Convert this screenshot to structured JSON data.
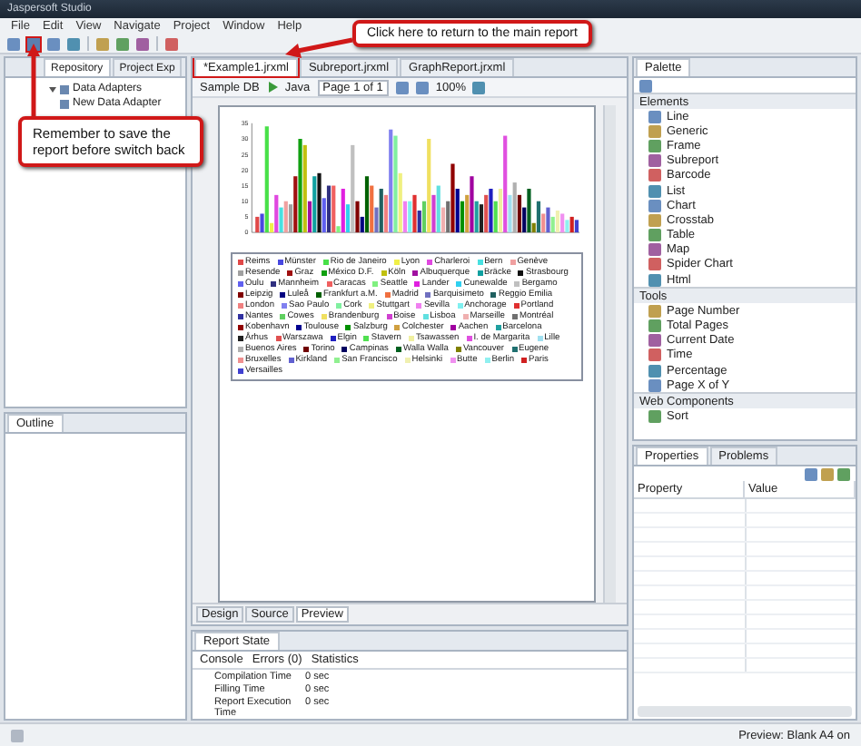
{
  "window": {
    "title": "Jaspersoft Studio"
  },
  "menu": [
    "File",
    "Edit",
    "View",
    "Navigate",
    "Project",
    "Window",
    "Help"
  ],
  "left_tabs": [
    {
      "label": "Repository",
      "selected": true
    },
    {
      "label": "Project Exp",
      "selected": false
    }
  ],
  "tree": [
    {
      "label": "Data Adapters",
      "expanded": true,
      "children": [
        {
          "label": "New Data Adapter"
        }
      ]
    }
  ],
  "outline": {
    "title": "Outline"
  },
  "editor_tabs": [
    {
      "label": "*Example1.jrxml",
      "selected": true
    },
    {
      "label": "Subreport.jrxml",
      "selected": false
    },
    {
      "label": "GraphReport.jrxml",
      "selected": false
    }
  ],
  "editor_toolbar": {
    "datasource": "Sample DB",
    "language": "Java",
    "page": "Page 1 of 1",
    "zoom": "100%"
  },
  "chart_data": {
    "type": "bar",
    "ylim": [
      0,
      35
    ],
    "yticks": [
      0,
      5,
      10,
      15,
      20,
      25,
      30,
      35
    ],
    "series": [
      {
        "name": "Reims",
        "color": "#e04848",
        "values": [
          5
        ]
      },
      {
        "name": "Münster",
        "color": "#4848e0",
        "values": [
          6
        ]
      },
      {
        "name": "Rio de Janeiro",
        "color": "#48e048",
        "values": [
          34
        ]
      },
      {
        "name": "Lyon",
        "color": "#f0f048",
        "values": [
          3
        ]
      },
      {
        "name": "Charleroi",
        "color": "#e048e0",
        "values": [
          12
        ]
      },
      {
        "name": "Bern",
        "color": "#48e0e0",
        "values": [
          8
        ]
      },
      {
        "name": "Genève",
        "color": "#f0a0a0",
        "values": [
          10
        ]
      },
      {
        "name": "Resende",
        "color": "#a0a0a0",
        "values": [
          9
        ]
      },
      {
        "name": "Graz",
        "color": "#a01010",
        "values": [
          18
        ]
      },
      {
        "name": "México D.F.",
        "color": "#10a010",
        "values": [
          30
        ]
      },
      {
        "name": "Köln",
        "color": "#c0c010",
        "values": [
          28
        ]
      },
      {
        "name": "Albuquerque",
        "color": "#a010a0",
        "values": [
          10
        ]
      },
      {
        "name": "Bräcke",
        "color": "#10a0a0",
        "values": [
          18
        ]
      },
      {
        "name": "Strasbourg",
        "color": "#101010",
        "values": [
          19
        ]
      },
      {
        "name": "Oulu",
        "color": "#6060f0",
        "values": [
          11
        ]
      },
      {
        "name": "Mannheim",
        "color": "#303080",
        "values": [
          15
        ]
      },
      {
        "name": "Caracas",
        "color": "#f06060",
        "values": [
          15
        ]
      },
      {
        "name": "Seattle",
        "color": "#80f080",
        "values": [
          2
        ]
      },
      {
        "name": "Lander",
        "color": "#e020e0",
        "values": [
          14
        ]
      },
      {
        "name": "Cunewalde",
        "color": "#30d0f0",
        "values": [
          9
        ]
      },
      {
        "name": "Bergamo",
        "color": "#c0c0c0",
        "values": [
          28
        ]
      },
      {
        "name": "Leipzig",
        "color": "#800000",
        "values": [
          10
        ]
      },
      {
        "name": "Luleå",
        "color": "#000080",
        "values": [
          5
        ]
      },
      {
        "name": "Frankfurt a.M.",
        "color": "#006000",
        "values": [
          18
        ]
      },
      {
        "name": "Madrid",
        "color": "#f07040",
        "values": [
          15
        ]
      },
      {
        "name": "Barquisimeto",
        "color": "#7070c0",
        "values": [
          8
        ]
      },
      {
        "name": "Reggio Emilia",
        "color": "#206060",
        "values": [
          14
        ]
      },
      {
        "name": "London",
        "color": "#f08080",
        "values": [
          12
        ]
      },
      {
        "name": "Sao Paulo",
        "color": "#8080f0",
        "values": [
          33
        ]
      },
      {
        "name": "Cork",
        "color": "#80f0a0",
        "values": [
          31
        ]
      },
      {
        "name": "Stuttgart",
        "color": "#f0f080",
        "values": [
          19
        ]
      },
      {
        "name": "Sevilla",
        "color": "#f080f0",
        "values": [
          10
        ]
      },
      {
        "name": "Anchorage",
        "color": "#80f0f0",
        "values": [
          10
        ]
      },
      {
        "name": "Portland",
        "color": "#e03030",
        "values": [
          12
        ]
      },
      {
        "name": "Nantes",
        "color": "#3030a0",
        "values": [
          7
        ]
      },
      {
        "name": "Cowes",
        "color": "#60d060",
        "values": [
          10
        ]
      },
      {
        "name": "Brandenburg",
        "color": "#f0e060",
        "values": [
          30
        ]
      },
      {
        "name": "Boise",
        "color": "#d040d0",
        "values": [
          12
        ]
      },
      {
        "name": "Lisboa",
        "color": "#60e0e0",
        "values": [
          15
        ]
      },
      {
        "name": "Marseille",
        "color": "#f0b0b0",
        "values": [
          8
        ]
      },
      {
        "name": "Montréal",
        "color": "#707070",
        "values": [
          10
        ]
      },
      {
        "name": "Kobenhavn",
        "color": "#900000",
        "values": [
          22
        ]
      },
      {
        "name": "Toulouse",
        "color": "#000090",
        "values": [
          14
        ]
      },
      {
        "name": "Salzburg",
        "color": "#009000",
        "values": [
          10
        ]
      },
      {
        "name": "Colchester",
        "color": "#d0a040",
        "values": [
          12
        ]
      },
      {
        "name": "Aachen",
        "color": "#a000a0",
        "values": [
          18
        ]
      },
      {
        "name": "Barcelona",
        "color": "#20a0a0",
        "values": [
          10
        ]
      },
      {
        "name": "Århus",
        "color": "#202020",
        "values": [
          9
        ]
      },
      {
        "name": "Warszawa",
        "color": "#e05050",
        "values": [
          12
        ]
      },
      {
        "name": "Elgin",
        "color": "#2020c0",
        "values": [
          14
        ]
      },
      {
        "name": "Stavern",
        "color": "#50e050",
        "values": [
          10
        ]
      },
      {
        "name": "Tsawassen",
        "color": "#f0f0a0",
        "values": [
          14
        ]
      },
      {
        "name": "I. de Margarita",
        "color": "#e050e0",
        "values": [
          31
        ]
      },
      {
        "name": "Lille",
        "color": "#a0e0f0",
        "values": [
          12
        ]
      },
      {
        "name": "Buenos Aires",
        "color": "#b0b0b0",
        "values": [
          16
        ]
      },
      {
        "name": "Torino",
        "color": "#700000",
        "values": [
          12
        ]
      },
      {
        "name": "Campinas",
        "color": "#000060",
        "values": [
          8
        ]
      },
      {
        "name": "Walla Walla",
        "color": "#006020",
        "values": [
          14
        ]
      },
      {
        "name": "Vancouver",
        "color": "#808000",
        "values": [
          3
        ]
      },
      {
        "name": "Eugene",
        "color": "#207070",
        "values": [
          10
        ]
      },
      {
        "name": "Bruxelles",
        "color": "#f09090",
        "values": [
          6
        ]
      },
      {
        "name": "Kirkland",
        "color": "#6060d0",
        "values": [
          8
        ]
      },
      {
        "name": "San Francisco",
        "color": "#90f090",
        "values": [
          5
        ]
      },
      {
        "name": "Helsinki",
        "color": "#f0f0b0",
        "values": [
          7
        ]
      },
      {
        "name": "Butte",
        "color": "#f090f0",
        "values": [
          6
        ]
      },
      {
        "name": "Berlin",
        "color": "#90f0f0",
        "values": [
          4
        ]
      },
      {
        "name": "Paris",
        "color": "#d02020",
        "values": [
          5
        ]
      },
      {
        "name": "Versailles",
        "color": "#4040d0",
        "values": [
          4
        ]
      }
    ]
  },
  "view_tabs": [
    {
      "label": "Design",
      "selected": false
    },
    {
      "label": "Source",
      "selected": false
    },
    {
      "label": "Preview",
      "selected": true
    }
  ],
  "report_state": {
    "title": "Report State",
    "tabs": [
      "Console",
      "Errors (0)",
      "Statistics"
    ],
    "rows": [
      {
        "label": "Compilation Time",
        "value": "0 sec"
      },
      {
        "label": "Filling Time",
        "value": "0 sec"
      },
      {
        "label": "Report Execution Time",
        "value": "0 sec"
      }
    ]
  },
  "palette": {
    "title": "Palette",
    "sections": [
      {
        "label": "Elements",
        "items": [
          "Line",
          "Generic",
          "Frame",
          "Subreport",
          "Barcode",
          "List",
          "Chart",
          "Crosstab",
          "Table",
          "Map",
          "Spider Chart",
          "Html"
        ]
      },
      {
        "label": "Tools",
        "items": [
          "Page Number",
          "Total Pages",
          "Current Date",
          "Time",
          "Percentage",
          "Page X of Y"
        ]
      },
      {
        "label": "Web Components",
        "items": [
          "Sort"
        ]
      }
    ]
  },
  "properties": {
    "tabs": [
      {
        "label": "Properties",
        "selected": true
      },
      {
        "label": "Problems",
        "selected": false
      }
    ],
    "columns": [
      "Property",
      "Value"
    ]
  },
  "status_bar": {
    "text": "Preview: Blank A4 on"
  },
  "callouts": [
    {
      "text": "Click here to return to the main report"
    },
    {
      "text": "Remember to save the report before switch back"
    }
  ]
}
